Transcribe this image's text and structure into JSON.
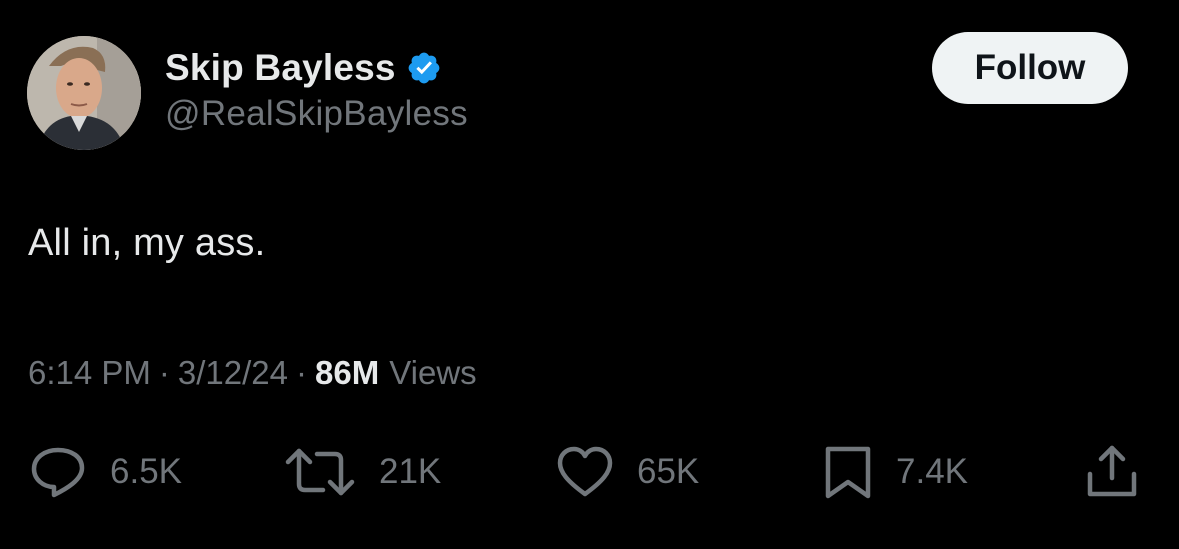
{
  "author": {
    "display_name": "Skip Bayless",
    "handle": "@RealSkipBayless",
    "verified": true,
    "verified_color": "#1d9bf0"
  },
  "follow_label": "Follow",
  "tweet": {
    "text": "All in, my ass.",
    "time": "6:14 PM",
    "separator": "·",
    "date": "3/12/24",
    "views_count": "86M",
    "views_label": "Views"
  },
  "actions": {
    "replies": {
      "icon": "reply-icon",
      "count": "6.5K"
    },
    "reposts": {
      "icon": "repost-icon",
      "count": "21K"
    },
    "likes": {
      "icon": "heart-icon",
      "count": "65K"
    },
    "bookmarks": {
      "icon": "bookmark-icon",
      "count": "7.4K"
    },
    "share": {
      "icon": "share-icon"
    }
  },
  "colors": {
    "background": "#000000",
    "primary_text": "#e7e9ea",
    "secondary_text": "#71767b",
    "follow_bg": "#eff3f4"
  }
}
